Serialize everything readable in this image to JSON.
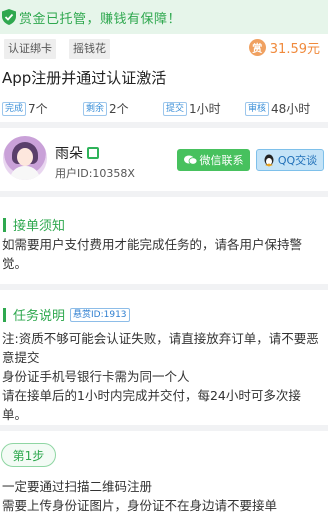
{
  "banner": {
    "text": "赏金已托管，赚钱有保障！"
  },
  "task": {
    "tags": [
      "认证绑卡",
      "摇钱花"
    ],
    "price": "31.59元",
    "coin_glyph": "赏",
    "title": "App注册并通过认证激活",
    "stats": [
      {
        "label": "完成",
        "value": "7个"
      },
      {
        "label": "剩余",
        "value": "2个"
      },
      {
        "label": "提交",
        "value": "1小时"
      },
      {
        "label": "审核",
        "value": "48小时"
      }
    ]
  },
  "user": {
    "name": "雨朵",
    "id": "用户ID:10358X",
    "wechat_button": "微信联系",
    "qq_button": "QQ交谈"
  },
  "notice": {
    "title": "接单须知",
    "text": "如需要用户支付费用才能完成任务的，请各用户保持警觉。"
  },
  "description": {
    "title": "任务说明",
    "badge": "悬赏ID:1913",
    "lines": [
      "注:资质不够可能会认证失败，请直接放弃订单，请不要恶意提交",
      "身份证手机号银行卡需为同一个人",
      "请在接单后的1小时内完成并交付，每24小时可多次接单。"
    ]
  },
  "step": {
    "label": "第1步",
    "lines": [
      "一定要通过扫描二维码注册",
      "需要上传身份证图片，身份证不在身边请不要接单"
    ]
  },
  "colors": {
    "accent_green": "#2fa84f",
    "price_orange": "#f08a3c",
    "blue": "#3a8fd8"
  }
}
